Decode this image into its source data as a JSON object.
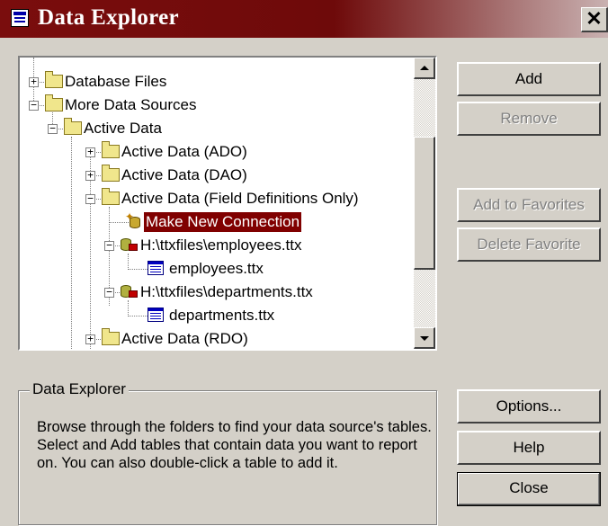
{
  "window": {
    "title": "Data Explorer",
    "close_glyph": "✕"
  },
  "tree": {
    "items": [
      {
        "label": "Database Files",
        "icon": "folder-icon",
        "expander": "+"
      },
      {
        "label": "More Data Sources",
        "icon": "folder-icon",
        "expander": "−"
      },
      {
        "label": "Active Data",
        "icon": "folder-icon",
        "expander": "−"
      },
      {
        "label": "Active Data (ADO)",
        "icon": "folder-icon",
        "expander": "+"
      },
      {
        "label": "Active Data (DAO)",
        "icon": "folder-icon",
        "expander": "+"
      },
      {
        "label": "Active Data (Field Definitions Only)",
        "icon": "folder-icon",
        "expander": "−"
      },
      {
        "label": "Make New Connection",
        "icon": "new-connection-icon",
        "expander": "",
        "selected": true
      },
      {
        "label": "H:\\ttxfiles\\employees.ttx",
        "icon": "database-connection-icon",
        "expander": "−"
      },
      {
        "label": "employees.ttx",
        "icon": "table-icon",
        "expander": ""
      },
      {
        "label": "H:\\ttxfiles\\departments.ttx",
        "icon": "database-connection-icon",
        "expander": "−"
      },
      {
        "label": "departments.ttx",
        "icon": "table-icon",
        "expander": ""
      },
      {
        "label": "Active Data (RDO)",
        "icon": "folder-icon",
        "expander": "+"
      }
    ]
  },
  "buttons": {
    "add": "Add",
    "remove": "Remove",
    "add_to_favorites": "Add to Favorites",
    "delete_favorite": "Delete Favorite",
    "options": "Options...",
    "help": "Help",
    "close": "Close"
  },
  "info": {
    "legend": "Data Explorer",
    "description": "Browse through the folders to find your data source's tables.  Select and Add tables that contain data you want to report on.  You can also double-click a table to add it."
  },
  "colors": {
    "titlebar": "#7a0d0d",
    "selection": "#800000",
    "face": "#d4d0c8"
  }
}
